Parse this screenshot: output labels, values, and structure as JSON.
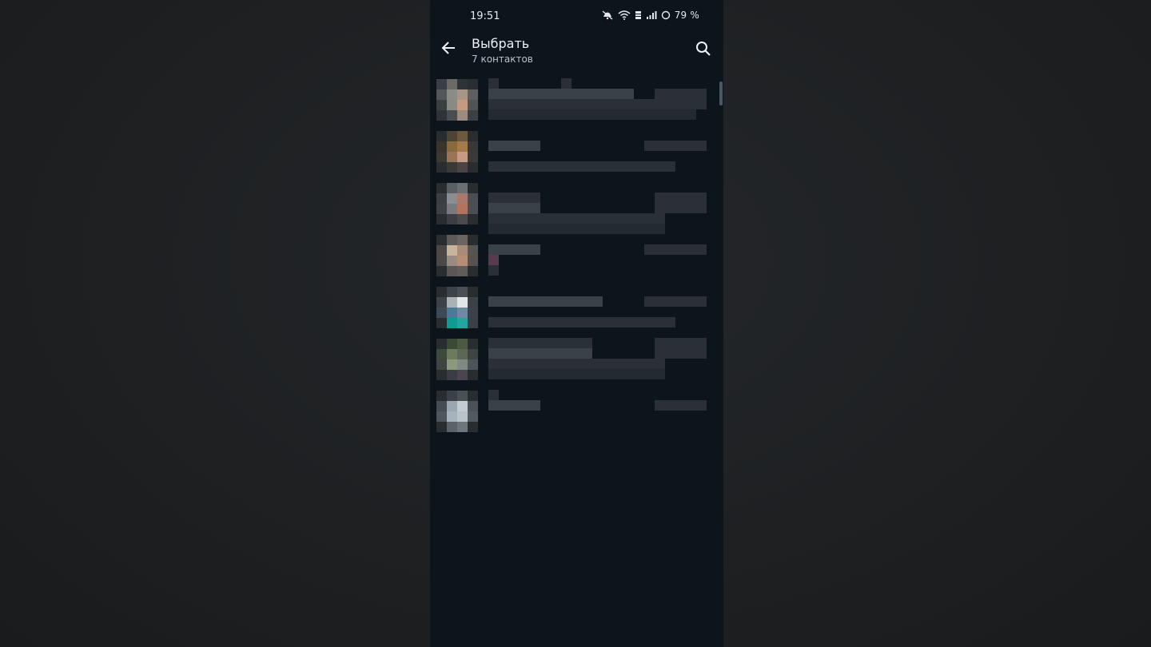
{
  "status_bar": {
    "time": "19:51",
    "battery": "79 %",
    "icons": [
      "mute-icon",
      "wifi-icon",
      "network-type-icon",
      "signal-icon",
      "battery-ring-icon"
    ]
  },
  "header": {
    "title": "Выбрать",
    "subtitle": "7 контактов",
    "back_icon": "arrow-left-icon",
    "search_icon": "search-icon"
  },
  "contacts": [
    {
      "avatar_colors": [
        "#3a3f45",
        "#6b6a66",
        "#2f3338",
        "#2a2d31",
        "#54575a",
        "#8c8c87",
        "#a79585",
        "#5d5f61",
        "#39403f",
        "#8a8a84",
        "#c49b82",
        "#505457",
        "#2f3337",
        "#4a4d50",
        "#9c8c80",
        "#3c4043"
      ]
    },
    {
      "avatar_colors": [
        "#2a2d30",
        "#4c4536",
        "#6b5a3e",
        "#2a2d30",
        "#3a352c",
        "#8a6a3c",
        "#a47a4a",
        "#3a3836",
        "#3c3833",
        "#9a7455",
        "#c59a86",
        "#3b3a39",
        "#2a2d30",
        "#3a3937",
        "#4a4442",
        "#2a2d30"
      ]
    },
    {
      "avatar_colors": [
        "#2a2d30",
        "#5a5f66",
        "#6a6f74",
        "#2a2d30",
        "#3b3f44",
        "#8a8e94",
        "#a97a6c",
        "#4a4e52",
        "#3d4146",
        "#777b80",
        "#b4735f",
        "#4b4f53",
        "#2a2d30",
        "#3b3f43",
        "#4c4a4a",
        "#2a2d30"
      ]
    },
    {
      "avatar_colors": [
        "#2a2d30",
        "#5d5a57",
        "#6a6560",
        "#2a2d30",
        "#4a4744",
        "#c8b39c",
        "#a78c7a",
        "#575552",
        "#4b4947",
        "#9a8b80",
        "#b88d77",
        "#55524f",
        "#2a2d30",
        "#5a5756",
        "#5f5c5a",
        "#2a2d30"
      ]
    },
    {
      "avatar_colors": [
        "#2a2d30",
        "#3d4349",
        "#4a5056",
        "#2a2d30",
        "#3c4248",
        "#a9b2b7",
        "#e3e6e6",
        "#3c4247",
        "#3d4a55",
        "#4a7a9a",
        "#6f8aa0",
        "#3b4146",
        "#2a2d30",
        "#0f9a92",
        "#23a69d",
        "#3a4045"
      ]
    },
    {
      "avatar_colors": [
        "#2a2d30",
        "#3b4a37",
        "#4c5a44",
        "#2a2d30",
        "#3c4a3c",
        "#6d7a5c",
        "#5d6755",
        "#3d4441",
        "#3e4540",
        "#8a9a7a",
        "#7e8a84",
        "#4d5457",
        "#2a2d30",
        "#3a3d43",
        "#4a4550",
        "#2a2d30"
      ]
    },
    {
      "avatar_colors": [
        "#2a2d30",
        "#3c4147",
        "#4a5056",
        "#2a2d30",
        "#454c54",
        "#9aa7b1",
        "#c4ccd2",
        "#4a5158",
        "#4f565d",
        "#a7b3bc",
        "#b9c3ca",
        "#525a61",
        "#2a2d30",
        "#5a626a",
        "#6e767d",
        "#2a2d30"
      ]
    }
  ]
}
